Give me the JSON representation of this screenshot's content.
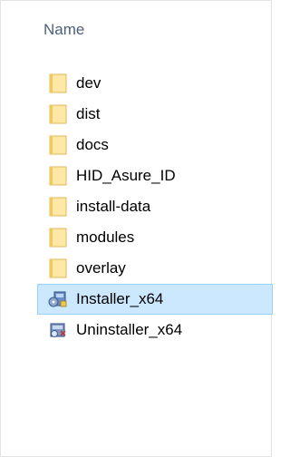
{
  "columns": {
    "name_header": "Name"
  },
  "items": [
    {
      "label": "dev",
      "type": "folder",
      "icon": "folder-icon",
      "selected": false
    },
    {
      "label": "dist",
      "type": "folder",
      "icon": "folder-icon",
      "selected": false
    },
    {
      "label": "docs",
      "type": "folder",
      "icon": "folder-icon",
      "selected": false
    },
    {
      "label": "HID_Asure_ID",
      "type": "folder",
      "icon": "folder-icon",
      "selected": false
    },
    {
      "label": "install-data",
      "type": "folder",
      "icon": "folder-icon",
      "selected": false
    },
    {
      "label": "modules",
      "type": "folder",
      "icon": "folder-icon",
      "selected": false
    },
    {
      "label": "overlay",
      "type": "folder",
      "icon": "folder-icon",
      "selected": false
    },
    {
      "label": "Installer_x64",
      "type": "application",
      "icon": "installer-icon",
      "selected": true
    },
    {
      "label": "Uninstaller_x64",
      "type": "application",
      "icon": "uninstaller-icon",
      "selected": false
    }
  ],
  "colors": {
    "selection_background": "#cce8ff",
    "selection_border": "#99d1ff",
    "folder_fill": "#ffe8a6",
    "header_text": "#4c607a"
  }
}
